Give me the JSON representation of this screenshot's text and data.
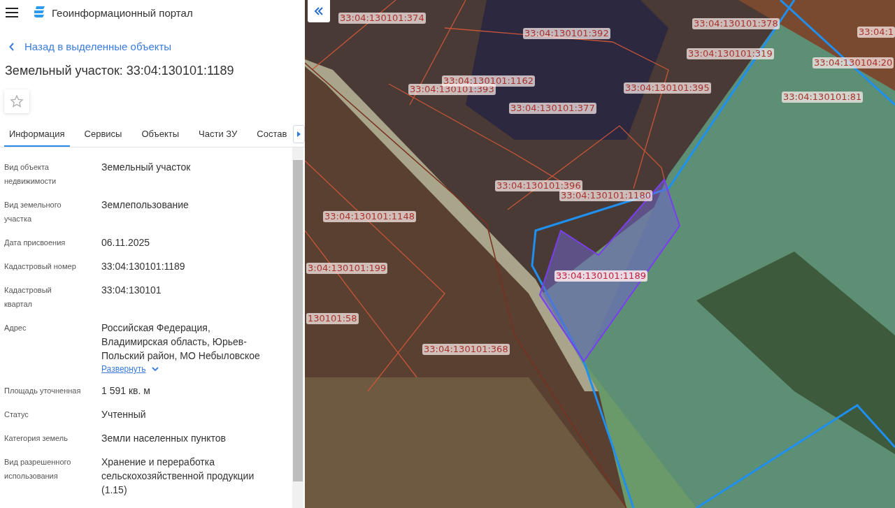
{
  "app": {
    "title": "Геоинформационный портал"
  },
  "back_link": "Назад в выделенные объекты",
  "object_title": "Земельный участок: 33:04:130101:1189",
  "favorite": {
    "on": false
  },
  "tabs": [
    {
      "label": "Информация",
      "selected": true
    },
    {
      "label": "Сервисы",
      "selected": false
    },
    {
      "label": "Объекты",
      "selected": false
    },
    {
      "label": "Части ЗУ",
      "selected": false
    },
    {
      "label": "Состав",
      "selected": false
    }
  ],
  "properties": [
    {
      "label": "Вид объекта недвижимости",
      "value": "Земельный участок"
    },
    {
      "label": "Вид земельного участка",
      "value": "Землепользование"
    },
    {
      "label": "Дата присвоения",
      "value": "06.11.2025"
    },
    {
      "label": "Кадастровый номер",
      "value": "33:04:130101:1189"
    },
    {
      "label": "Кадастровый квартал",
      "value": "33:04:130101"
    },
    {
      "label": "Адрес",
      "value": "Российская Федерация, Владимирская область, Юрьев-Польский район, МО Небыловское",
      "expand_link": "Развернуть"
    },
    {
      "label": "Площадь уточненная",
      "value": "1 591 кв. м"
    },
    {
      "label": "Статус",
      "value": "Учтенный"
    },
    {
      "label": "Категория земель",
      "value": "Земли населенных пунктов"
    },
    {
      "label": "Вид разрешенного использования",
      "value": "Хранение и переработка сельскохозяйственной продукции (1.15)"
    }
  ],
  "map": {
    "parcel_labels": [
      {
        "text": "33:04:130101:374",
        "selected": false
      },
      {
        "text": "33:04:130101:392",
        "selected": false
      },
      {
        "text": "33:04:130101:378",
        "selected": false
      },
      {
        "text": "33:04:1",
        "selected": false
      },
      {
        "text": "33:04:130101:319",
        "selected": false
      },
      {
        "text": "33:04:130104:20",
        "selected": false
      },
      {
        "text": "33:04:130101:393",
        "selected": false
      },
      {
        "text": "33:04:130101:1162",
        "selected": false
      },
      {
        "text": "33:04:130101:395",
        "selected": false
      },
      {
        "text": "33:04:130101:81",
        "selected": false
      },
      {
        "text": "33:04:130101:377",
        "selected": false
      },
      {
        "text": "33:04:130101:396",
        "selected": false
      },
      {
        "text": "33:04:130101:1180",
        "selected": false
      },
      {
        "text": "33:04:130101:1148",
        "selected": false
      },
      {
        "text": "3:04:130101:199",
        "selected": false
      },
      {
        "text": "33:04:130101:1189",
        "selected": true
      },
      {
        "text": "130101:58",
        "selected": false
      },
      {
        "text": "33:04:130101:368",
        "selected": false
      }
    ]
  }
}
